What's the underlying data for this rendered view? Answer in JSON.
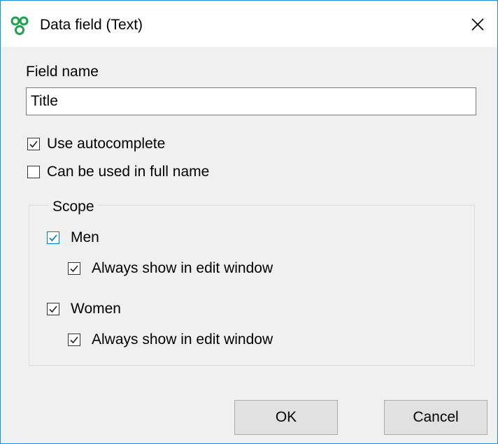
{
  "window": {
    "title": "Data field (Text)",
    "app_icon": "app-logo-icon",
    "close_icon": "close-icon",
    "accent_color": "#1b8fd6"
  },
  "field_name": {
    "label": "Field name",
    "value": "Title"
  },
  "options": {
    "use_autocomplete": {
      "label": "Use autocomplete",
      "checked": true
    },
    "full_name": {
      "label": "Can be used in full name",
      "checked": false
    }
  },
  "scope": {
    "title": "Scope",
    "men": {
      "label": "Men",
      "checked": true
    },
    "men_always_show": {
      "label": "Always show in edit window",
      "checked": true
    },
    "women": {
      "label": "Women",
      "checked": true
    },
    "women_always_show": {
      "label": "Always show in edit window",
      "checked": true
    }
  },
  "buttons": {
    "ok": "OK",
    "cancel": "Cancel"
  }
}
